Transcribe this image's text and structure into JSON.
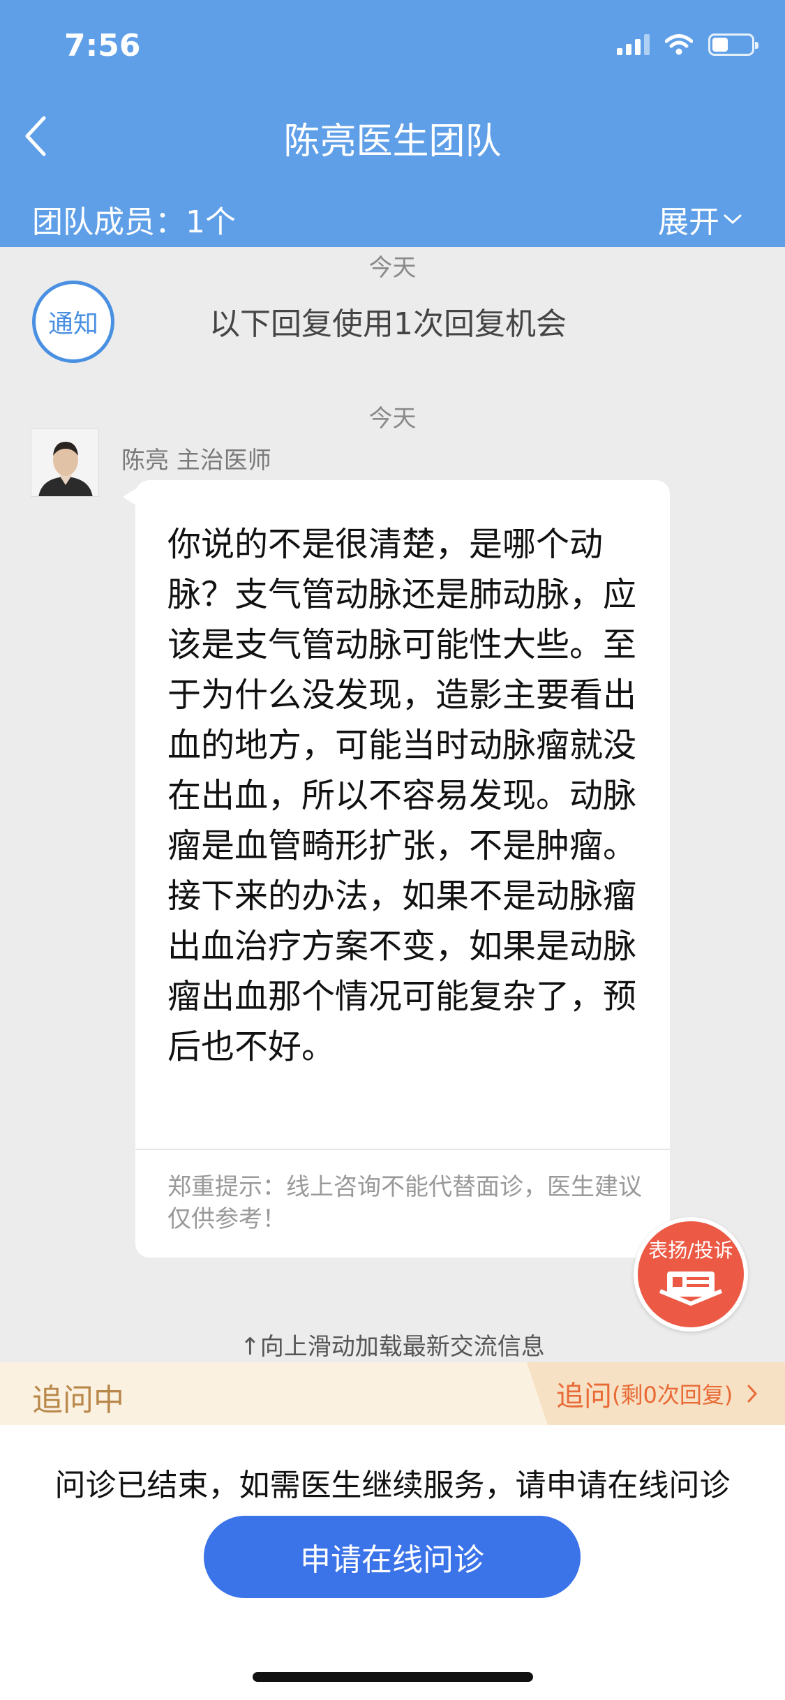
{
  "status_bar": {
    "time": "7:56"
  },
  "header": {
    "title": "陈亮医生团队",
    "team_members": "团队成员：1个",
    "expand_label": "展开"
  },
  "chat": {
    "date_1": "今天",
    "notice_badge": "通知",
    "notice_text": "以下回复使用1次回复机会",
    "date_2": "今天",
    "doctor_name": "陈亮 主治医师",
    "message": "你说的不是很清楚，是哪个动脉？支气管动脉还是肺动脉，应该是支气管动脉可能性大些。至于为什么没发现，造影主要看出血的地方，可能当时动脉瘤就没在出血，所以不容易发现。动脉瘤是血管畸形扩张，不是肿瘤。接下来的办法，如果不是动脉瘤出血治疗方案不变，如果是动脉瘤出血那个情况可能复杂了，预后也不好。",
    "disclaimer": "郑重提示：线上咨询不能代替面诊，医生建议仅供参考！",
    "praise_button": "表扬/投诉",
    "scroll_hint": "↑向上滑动加载最新交流信息"
  },
  "followup": {
    "status": "追问中",
    "action_label": "追问",
    "remaining": "(剩0次回复)"
  },
  "bottom": {
    "ended_text": "问诊已结束，如需医生继续服务，请申请在线问诊",
    "apply_button": "申请在线问诊"
  },
  "colors": {
    "header_bg": "#5f9fe8",
    "primary_button": "#3b73e8",
    "praise_red": "#ec5a45",
    "followup_orange": "#e86a36"
  }
}
